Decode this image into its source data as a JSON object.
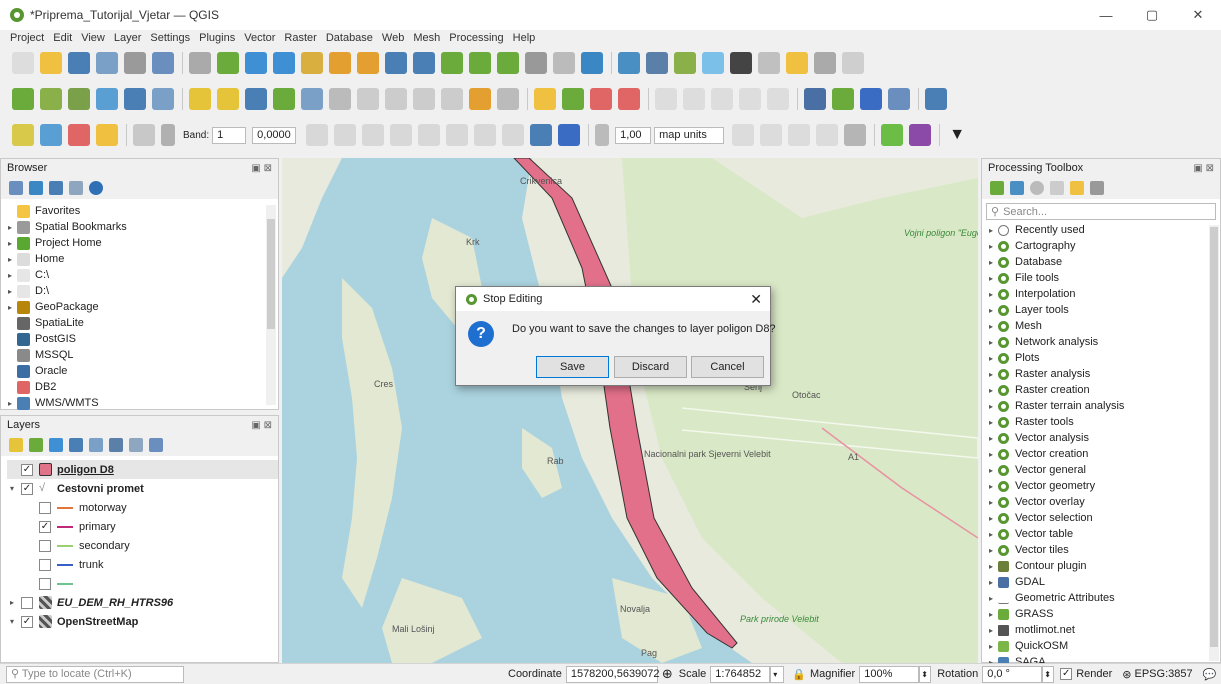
{
  "window": {
    "title": "*Priprema_Tutorijal_Vjetar — QGIS",
    "minimize": "—",
    "maximize": "▢",
    "close": "✕"
  },
  "menu": [
    "Project",
    "Edit",
    "View",
    "Layer",
    "Settings",
    "Plugins",
    "Vector",
    "Raster",
    "Database",
    "Web",
    "Mesh",
    "Processing",
    "Help"
  ],
  "toolbar3": {
    "band_label": "Band:",
    "band_value": "1",
    "band_input": "0,0000",
    "width_value": "1,00",
    "units": "map units"
  },
  "browser": {
    "title": "Browser",
    "items": [
      {
        "label": "Favorites",
        "icon": "star-icon",
        "color": "#f4c542",
        "arrow": ""
      },
      {
        "label": "Spatial Bookmarks",
        "icon": "bookmark-icon",
        "color": "#9a9a9a",
        "arrow": "▸"
      },
      {
        "label": "Project Home",
        "icon": "project-home-icon",
        "color": "#5aa832",
        "arrow": "▸"
      },
      {
        "label": "Home",
        "icon": "home-icon",
        "color": "#dcdcdc",
        "arrow": "▸"
      },
      {
        "label": "C:\\",
        "icon": "folder-icon",
        "color": "#e6e6e6",
        "arrow": "▸"
      },
      {
        "label": "D:\\",
        "icon": "folder-icon",
        "color": "#e6e6e6",
        "arrow": "▸"
      },
      {
        "label": "GeoPackage",
        "icon": "geopackage-icon",
        "color": "#b8860b",
        "arrow": "▸"
      },
      {
        "label": "SpatiaLite",
        "icon": "spatialite-icon",
        "color": "#666",
        "arrow": ""
      },
      {
        "label": "PostGIS",
        "icon": "postgis-icon",
        "color": "#336791",
        "arrow": ""
      },
      {
        "label": "MSSQL",
        "icon": "mssql-icon",
        "color": "#8a8a8a",
        "arrow": ""
      },
      {
        "label": "Oracle",
        "icon": "oracle-icon",
        "color": "#3c6ea5",
        "arrow": ""
      },
      {
        "label": "DB2",
        "icon": "db2-icon",
        "color": "#e06666",
        "arrow": ""
      },
      {
        "label": "WMS/WMTS",
        "icon": "wms-icon",
        "color": "#4a7fb5",
        "arrow": "▸"
      }
    ]
  },
  "layers": {
    "title": "Layers",
    "items": [
      {
        "label": "poligon D8",
        "checked": "✓",
        "arrow": "",
        "bold": true,
        "italic": false,
        "sym": "#e0728a",
        "indent": 0,
        "kind": "poly"
      },
      {
        "label": "Cestovni promet",
        "checked": "✓",
        "arrow": "▾",
        "bold": true,
        "italic": false,
        "sym": "#888",
        "indent": 0,
        "kind": "vline"
      },
      {
        "label": "motorway",
        "checked": "",
        "arrow": "",
        "bold": false,
        "italic": false,
        "sym": "#e2763a",
        "indent": 1,
        "kind": "line"
      },
      {
        "label": "primary",
        "checked": "✓",
        "arrow": "",
        "bold": false,
        "italic": false,
        "sym": "#c0287a",
        "indent": 1,
        "kind": "line"
      },
      {
        "label": "secondary",
        "checked": "",
        "arrow": "",
        "bold": false,
        "italic": false,
        "sym": "#9ccf72",
        "indent": 1,
        "kind": "line"
      },
      {
        "label": "trunk",
        "checked": "",
        "arrow": "",
        "bold": false,
        "italic": false,
        "sym": "#3a5fc4",
        "indent": 1,
        "kind": "line"
      },
      {
        "label": "",
        "checked": "",
        "arrow": "",
        "bold": false,
        "italic": false,
        "sym": "#6fc28f",
        "indent": 1,
        "kind": "line"
      },
      {
        "label": "EU_DEM_RH_HTRS96",
        "checked": "",
        "arrow": "▸",
        "bold": true,
        "italic": true,
        "sym": "#555",
        "indent": 0,
        "kind": "raster"
      },
      {
        "label": "OpenStreetMap",
        "checked": "✓",
        "arrow": "▾",
        "bold": true,
        "italic": false,
        "sym": "#555",
        "indent": 0,
        "kind": "raster"
      }
    ]
  },
  "processing": {
    "title": "Processing Toolbox",
    "search_placeholder": "Search...",
    "items": [
      {
        "label": "Recently used",
        "icon": "clock-icon"
      },
      {
        "label": "Cartography",
        "icon": "qgis-icon"
      },
      {
        "label": "Database",
        "icon": "qgis-icon"
      },
      {
        "label": "File tools",
        "icon": "qgis-icon"
      },
      {
        "label": "Interpolation",
        "icon": "qgis-icon"
      },
      {
        "label": "Layer tools",
        "icon": "qgis-icon"
      },
      {
        "label": "Mesh",
        "icon": "qgis-icon"
      },
      {
        "label": "Network analysis",
        "icon": "qgis-icon"
      },
      {
        "label": "Plots",
        "icon": "qgis-icon"
      },
      {
        "label": "Raster analysis",
        "icon": "qgis-icon"
      },
      {
        "label": "Raster creation",
        "icon": "qgis-icon"
      },
      {
        "label": "Raster terrain analysis",
        "icon": "qgis-icon"
      },
      {
        "label": "Raster tools",
        "icon": "qgis-icon"
      },
      {
        "label": "Vector analysis",
        "icon": "qgis-icon"
      },
      {
        "label": "Vector creation",
        "icon": "qgis-icon"
      },
      {
        "label": "Vector general",
        "icon": "qgis-icon"
      },
      {
        "label": "Vector geometry",
        "icon": "qgis-icon"
      },
      {
        "label": "Vector overlay",
        "icon": "qgis-icon"
      },
      {
        "label": "Vector selection",
        "icon": "qgis-icon"
      },
      {
        "label": "Vector table",
        "icon": "qgis-icon"
      },
      {
        "label": "Vector tiles",
        "icon": "qgis-icon"
      },
      {
        "label": "Contour plugin",
        "icon": "contour-icon"
      },
      {
        "label": "GDAL",
        "icon": "gdal-icon"
      },
      {
        "label": "Geometric Attributes",
        "icon": "geometric-icon"
      },
      {
        "label": "GRASS",
        "icon": "grass-icon"
      },
      {
        "label": "motlimot.net",
        "icon": "motlimot-icon"
      },
      {
        "label": "QuickOSM",
        "icon": "quickosm-icon"
      },
      {
        "label": "SAGA",
        "icon": "saga-icon"
      }
    ]
  },
  "map_labels": [
    {
      "text": "Krk"
    },
    {
      "text": "Cres"
    },
    {
      "text": "Rab"
    },
    {
      "text": "Novalja"
    },
    {
      "text": "Pag"
    },
    {
      "text": "Park prirode Velebit"
    },
    {
      "text": "Otočac"
    },
    {
      "text": "Vojni poligon \"Eugen Kvaternik\""
    },
    {
      "text": "A1"
    },
    {
      "text": "Mali Lošinj"
    },
    {
      "text": "Crikvenica"
    },
    {
      "text": "Senj"
    },
    {
      "text": "Nacionalni park Sjeverni Velebit"
    }
  ],
  "dialog": {
    "title": "Stop Editing",
    "message": "Do you want to save the changes to layer poligon D8?",
    "save": "Save",
    "discard": "Discard",
    "cancel": "Cancel"
  },
  "status": {
    "locate_placeholder": "Type to locate (Ctrl+K)",
    "coordinate_label": "Coordinate",
    "coordinate_value": "1578200,5639072",
    "scale_label": "Scale",
    "scale_value": "1:764852",
    "magnifier_label": "Magnifier",
    "magnifier_value": "100%",
    "rotation_label": "Rotation",
    "rotation_value": "0,0 °",
    "render_label": "Render",
    "epsg": "EPSG:3857"
  }
}
